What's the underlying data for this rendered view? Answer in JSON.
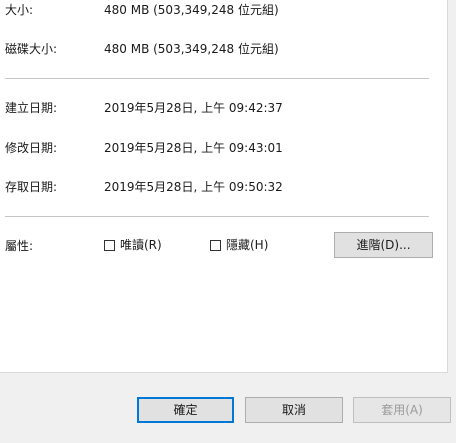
{
  "rows_top": [
    {
      "label": "大小:",
      "value": "480 MB (503,349,248 位元組)"
    },
    {
      "label": "磁碟大小:",
      "value": "480 MB (503,349,248 位元組)"
    }
  ],
  "rows_dates": [
    {
      "label": "建立日期:",
      "value": "2019年5月28日, 上午 09:42:37"
    },
    {
      "label": "修改日期:",
      "value": "2019年5月28日, 上午 09:43:01"
    },
    {
      "label": "存取日期:",
      "value": "2019年5月28日, 上午 09:50:32"
    }
  ],
  "attributes": {
    "label": "屬性:",
    "readonly_label": "唯讀(R)",
    "readonly_checked": false,
    "hidden_label": "隱藏(H)",
    "hidden_checked": false,
    "advanced_label": "進階(D)..."
  },
  "footer": {
    "ok_label": "確定",
    "cancel_label": "取消",
    "apply_label": "套用(A)",
    "apply_enabled": false
  }
}
